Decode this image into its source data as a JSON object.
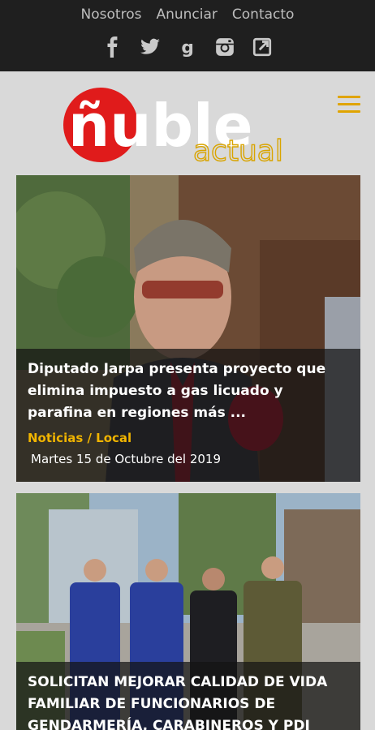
{
  "topnav": {
    "items": [
      "Nosotros",
      "Anunciar",
      "Contacto"
    ]
  },
  "social": {
    "icons": [
      "facebook-icon",
      "twitter-icon",
      "google-icon",
      "instagram-icon",
      "external-link-icon"
    ]
  },
  "logo": {
    "main": "ñuble",
    "sub": "actual"
  },
  "colors": {
    "accent": "#f0b400",
    "logo_red": "#e01b1b",
    "topbar": "#1f1f1f"
  },
  "articles": [
    {
      "headline": "Diputado Jarpa presenta proyecto que elimina impuesto a gas licuado y parafina en regiones más ...",
      "category": "Noticias / Local",
      "date": "Martes 15 de Octubre del 2019"
    },
    {
      "headline": "SOLICITAN MEJORAR CALIDAD DE VIDA FAMILIAR DE FUNCIONARIOS DE GENDARMERÍA, CARABINEROS Y PDI"
    }
  ]
}
